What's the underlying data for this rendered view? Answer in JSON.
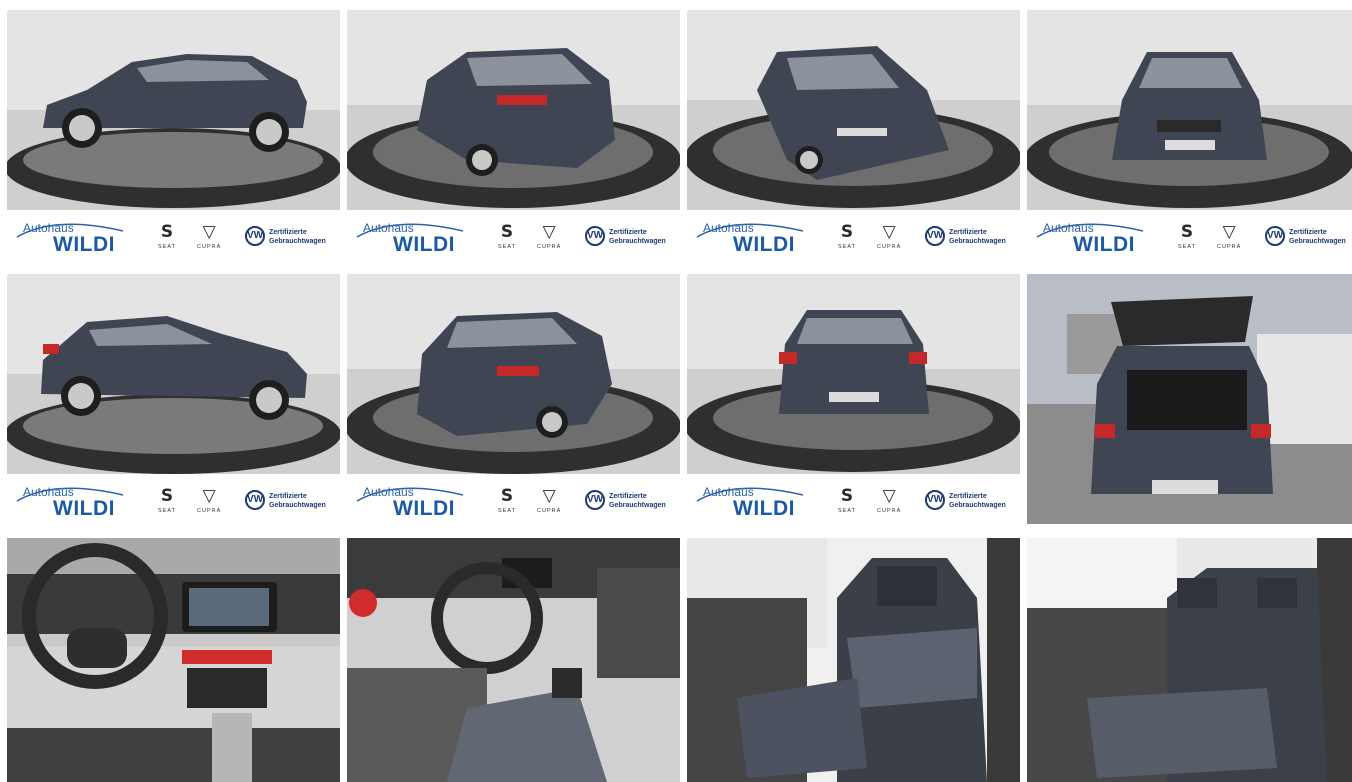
{
  "gallery": {
    "dealer_prefix": "Autohaus",
    "dealer_name": "WILDI",
    "brand_seat": "SEAT",
    "brand_cupra": "CUPRA",
    "vw_mark": "VW",
    "certified_line1": "Zertifizierte",
    "certified_line2": "Gebrauchtwagen",
    "colors": {
      "car_body": "#3f4552",
      "studio_wall": "#dedede",
      "turntable": "#3a3a3a",
      "brand_blue": "#1d5aa6",
      "interior_red": "#d02c2c"
    }
  }
}
